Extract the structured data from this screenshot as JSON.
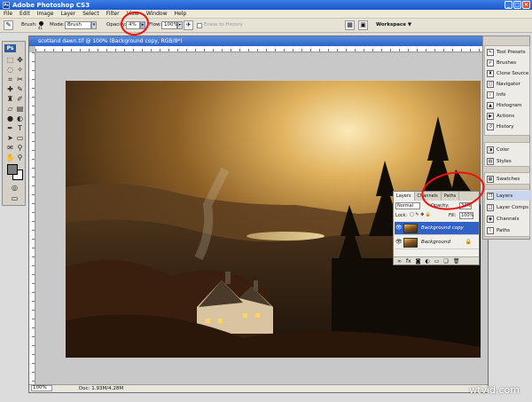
{
  "window": {
    "title": "Adobe Photoshop CS3",
    "app_icon": "Ps",
    "buttons": [
      "_",
      "□",
      "×"
    ]
  },
  "menu": [
    "File",
    "Edit",
    "Image",
    "Layer",
    "Select",
    "Filter",
    "View",
    "Window",
    "Help"
  ],
  "options": {
    "brush_label": "Brush:",
    "brush_size": "41",
    "mode_label": "Mode:",
    "mode_value": "Brush",
    "opacity_label": "Opacity:",
    "opacity_value": "4%",
    "flow_label": "Flow:",
    "flow_value": "100%",
    "erase_history_label": "Erase to History",
    "workspace_label": "Workspace ▼"
  },
  "toolbox": {
    "logo": "Ps"
  },
  "document": {
    "title": "scotland dawn.tif @ 100% (Background copy, RGB/8*)",
    "zoom": "100%",
    "doc_size": "Doc: 1.93M/4.28M"
  },
  "dock": {
    "group1": [
      "Tool Presets",
      "Brushes",
      "Clone Source",
      "Navigator",
      "Info",
      "Histogram",
      "Actions",
      "History"
    ],
    "group2": [
      "Color",
      "Styles"
    ],
    "group3": [
      "Swatches"
    ],
    "group4": [
      "Layers",
      "Layer Comps",
      "Channels",
      "Paths"
    ]
  },
  "layers_panel": {
    "tabs": [
      "Layers",
      "Channels",
      "Paths"
    ],
    "blend_mode": "Normal",
    "opacity_label": "Opacity:",
    "opacity_value": "34%",
    "lock_label": "Lock:",
    "fill_label": "Fill:",
    "fill_value": "100%",
    "layers": [
      {
        "name": "Background copy",
        "selected": true
      },
      {
        "name": "Background",
        "selected": false
      }
    ],
    "footer_icons": [
      "link-icon",
      "fx-icon",
      "mask-icon",
      "adjustment-icon",
      "folder-icon",
      "new-layer-icon",
      "trash-icon"
    ]
  },
  "watermark": "wtvid.com",
  "colors": {
    "highlight": "#e11111",
    "title_blue": "#2b63c8"
  }
}
